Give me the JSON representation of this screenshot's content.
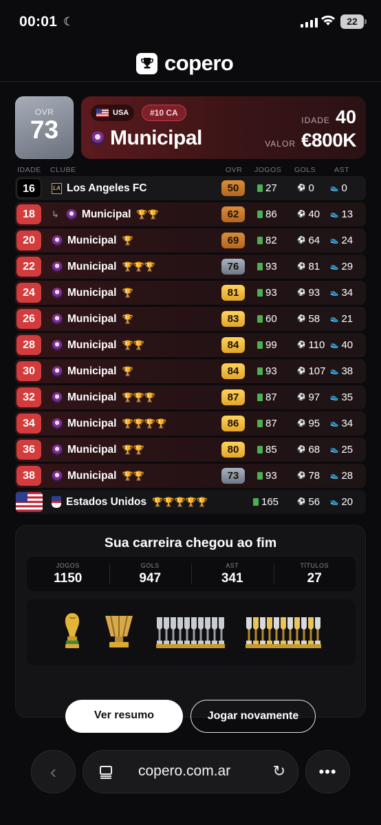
{
  "status": {
    "time": "00:01",
    "battery": "22"
  },
  "app": {
    "name": "copero"
  },
  "player": {
    "ovr_label": "OVR",
    "ovr": "73",
    "country": "USA",
    "number_badge": "#10 CA",
    "club": "Municipal",
    "age_label": "IDADE",
    "age": "40",
    "value_label": "VALOR",
    "value": "€800K"
  },
  "table": {
    "headers": {
      "age": "IDADE",
      "club": "CLUBE",
      "ovr": "OVR",
      "games": "JOGOS",
      "goals": "GOLS",
      "assists": "AST"
    },
    "rows": [
      {
        "age": "16",
        "club": "Los Angeles FC",
        "trophies": "",
        "ovr": "50",
        "games": "27",
        "goals": "0",
        "assists": "0"
      },
      {
        "age": "18",
        "club": "Municipal",
        "trophies": "🏆🏆",
        "ovr": "62",
        "games": "86",
        "goals": "40",
        "assists": "13"
      },
      {
        "age": "20",
        "club": "Municipal",
        "trophies": "🏆",
        "ovr": "69",
        "games": "82",
        "goals": "64",
        "assists": "24"
      },
      {
        "age": "22",
        "club": "Municipal",
        "trophies": "🏆🏆🏆",
        "ovr": "76",
        "games": "93",
        "goals": "81",
        "assists": "29"
      },
      {
        "age": "24",
        "club": "Municipal",
        "trophies": "🏆",
        "ovr": "81",
        "games": "93",
        "goals": "93",
        "assists": "34"
      },
      {
        "age": "26",
        "club": "Municipal",
        "trophies": "🏆",
        "ovr": "83",
        "games": "60",
        "goals": "58",
        "assists": "21"
      },
      {
        "age": "28",
        "club": "Municipal",
        "trophies": "🏆🏆",
        "ovr": "84",
        "games": "99",
        "goals": "110",
        "assists": "40"
      },
      {
        "age": "30",
        "club": "Municipal",
        "trophies": "🏆",
        "ovr": "84",
        "games": "93",
        "goals": "107",
        "assists": "38"
      },
      {
        "age": "32",
        "club": "Municipal",
        "trophies": "🏆🏆🏆",
        "ovr": "87",
        "games": "87",
        "goals": "97",
        "assists": "35"
      },
      {
        "age": "34",
        "club": "Municipal",
        "trophies": "🏆🏆🏆🏆",
        "ovr": "86",
        "games": "87",
        "goals": "95",
        "assists": "34"
      },
      {
        "age": "36",
        "club": "Municipal",
        "trophies": "🏆🏆",
        "ovr": "80",
        "games": "85",
        "goals": "68",
        "assists": "25"
      },
      {
        "age": "38",
        "club": "Municipal",
        "trophies": "🏆🏆",
        "ovr": "73",
        "games": "93",
        "goals": "78",
        "assists": "28"
      }
    ],
    "national": {
      "club": "Estados Unidos",
      "trophies": "🏆🏆🏆🏆🏆",
      "games": "165",
      "goals": "56",
      "assists": "20"
    }
  },
  "career": {
    "title": "Sua carreira chegou ao fim",
    "stats": [
      {
        "label": "JOGOS",
        "value": "1150"
      },
      {
        "label": "GOLS",
        "value": "947"
      },
      {
        "label": "AST",
        "value": "341"
      },
      {
        "label": "TÍTULOS",
        "value": "27"
      }
    ],
    "buttons": {
      "summary": "Ver resumo",
      "again": "Jogar novamente"
    }
  },
  "browser": {
    "url": "copero.com.ar"
  },
  "colors": {
    "ovr_bronze": "#c67a2c",
    "ovr_gold": "#f0b93a",
    "ovr_silver": "#8f98a6",
    "age_red": "#d23c3c"
  }
}
